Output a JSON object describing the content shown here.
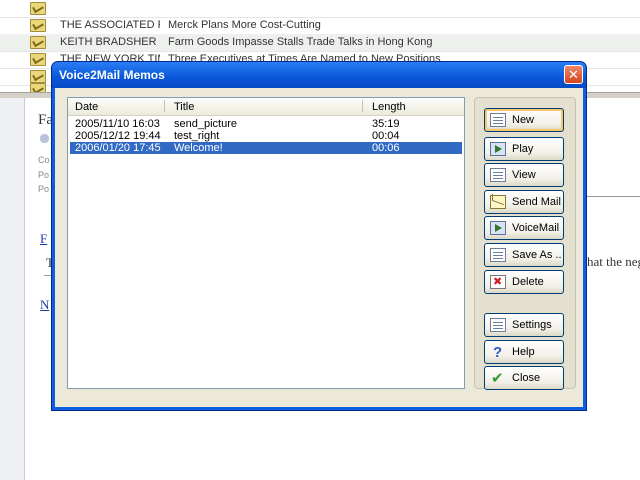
{
  "background_mail": {
    "rows": [
      {
        "from": "",
        "subject": "",
        "alt": false
      },
      {
        "from": "THE ASSOCIATED P...",
        "subject": "Merck Plans More Cost-Cutting",
        "alt": false
      },
      {
        "from": "KEITH BRADSHER",
        "subject": "Farm Goods Impasse Stalls Trade Talks in Hong Kong",
        "alt": true
      },
      {
        "from": "THE NEW YORK TIMES",
        "subject": "Three Executives at Times Are Named to New Positions",
        "alt": false
      },
      {
        "from": "",
        "subject": "",
        "alt": false
      },
      {
        "from": "",
        "subject": "",
        "alt": false
      }
    ],
    "fragments": {
      "fa": "Fa",
      "co": "Co",
      "po1": "Po",
      "po2": "Po",
      "fa_link": "F",
      "t": "T",
      "n_link": "N",
      "right_text": "hat the neg"
    }
  },
  "dialog": {
    "title": "Voice2Mail Memos",
    "close_label": "✕",
    "columns": {
      "date": "Date",
      "title": "Title",
      "length": "Length"
    },
    "memos": [
      {
        "date": "2005/11/10 16:03",
        "title": "send_picture",
        "length": "35:19",
        "selected": false
      },
      {
        "date": "2005/12/12 19:44",
        "title": "test_right",
        "length": "00:04",
        "selected": false
      },
      {
        "date": "2006/01/20 17:45",
        "title": "Welcome!",
        "length": "00:06",
        "selected": true
      }
    ],
    "buttons": {
      "new": "New",
      "play": "Play",
      "view": "View",
      "send_mail": "Send Mail",
      "voicemail": "VoiceMail",
      "save_as": "Save As ..",
      "delete": "Delete",
      "settings": "Settings",
      "help": "Help",
      "close": "Close"
    },
    "icons": {
      "help": "?",
      "close_check": "✔"
    },
    "colors": {
      "titlebar": "#0a57d8",
      "selection": "#316ac5",
      "face": "#ece9d8"
    }
  }
}
